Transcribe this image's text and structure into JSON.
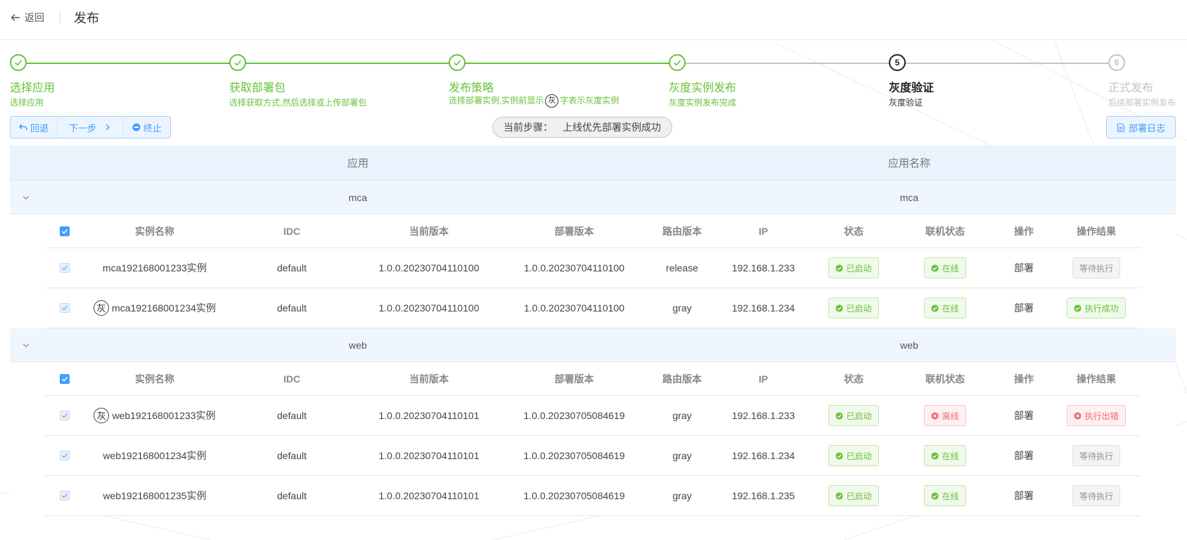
{
  "header": {
    "back_label": "返回",
    "title": "发布"
  },
  "steps": [
    {
      "num": "1",
      "title": "选择应用",
      "desc": "选择应用",
      "state": "done"
    },
    {
      "num": "2",
      "title": "获取部署包",
      "desc": "选择获取方式,然后选择或上传部署包",
      "state": "done"
    },
    {
      "num": "3",
      "title": "发布策略",
      "desc_pre": "选择部署实例,实例前显示",
      "desc_mark": "灰",
      "desc_post": "字表示灰度实例",
      "state": "done"
    },
    {
      "num": "4",
      "title": "灰度实例发布",
      "desc": "灰度实例发布完成",
      "state": "done"
    },
    {
      "num": "5",
      "title": "灰度验证",
      "desc": "灰度验证",
      "state": "current"
    },
    {
      "num": "6",
      "title": "正式发布",
      "desc": "后续部署实例发布",
      "state": "pending"
    }
  ],
  "toolbar": {
    "rollback_label": "回退",
    "next_label": "下一步",
    "stop_label": "终止",
    "current_step_label": "当前步骤：",
    "current_step_value": "上线优先部署实例成功",
    "log_label": "部署日志"
  },
  "table": {
    "head_app": "应用",
    "head_app_name": "应用名称",
    "sub_headers": {
      "name": "实例名称",
      "idc": "IDC",
      "current_version": "当前版本",
      "deploy_version": "部署版本",
      "route_version": "路由版本",
      "ip": "IP",
      "status": "状态",
      "online_status": "联机状态",
      "operation": "操作",
      "result": "操作结果"
    },
    "groups": [
      {
        "app": "mca",
        "app_name": "mca",
        "rows": [
          {
            "gray": false,
            "gray_mark": "",
            "name": "mca192168001233实例",
            "idc": "default",
            "current_version": "1.0.0.20230704110100",
            "deploy_version": "1.0.0.20230704110100",
            "route_version": "release",
            "ip": "192.168.1.233",
            "status": "已启动",
            "online": "在线",
            "online_state": "green",
            "operation": "部署",
            "result": "等待执行",
            "result_state": "grey"
          },
          {
            "gray": true,
            "gray_mark": "灰",
            "name": "mca192168001234实例",
            "idc": "default",
            "current_version": "1.0.0.20230704110100",
            "deploy_version": "1.0.0.20230704110100",
            "route_version": "gray",
            "ip": "192.168.1.234",
            "status": "已启动",
            "online": "在线",
            "online_state": "green",
            "operation": "部署",
            "result": "执行成功",
            "result_state": "green"
          }
        ]
      },
      {
        "app": "web",
        "app_name": "web",
        "rows": [
          {
            "gray": true,
            "gray_mark": "灰",
            "name": "web192168001233实例",
            "idc": "default",
            "current_version": "1.0.0.20230704110101",
            "deploy_version": "1.0.0.20230705084619",
            "route_version": "gray",
            "ip": "192.168.1.233",
            "status": "已启动",
            "online": "离线",
            "online_state": "red",
            "operation": "部署",
            "result": "执行出错",
            "result_state": "red"
          },
          {
            "gray": false,
            "gray_mark": "",
            "name": "web192168001234实例",
            "idc": "default",
            "current_version": "1.0.0.20230704110101",
            "deploy_version": "1.0.0.20230705084619",
            "route_version": "gray",
            "ip": "192.168.1.234",
            "status": "已启动",
            "online": "在线",
            "online_state": "green",
            "operation": "部署",
            "result": "等待执行",
            "result_state": "grey"
          },
          {
            "gray": false,
            "gray_mark": "",
            "name": "web192168001235实例",
            "idc": "default",
            "current_version": "1.0.0.20230704110101",
            "deploy_version": "1.0.0.20230705084619",
            "route_version": "gray",
            "ip": "192.168.1.235",
            "status": "已启动",
            "online": "在线",
            "online_state": "green",
            "operation": "部署",
            "result": "等待执行",
            "result_state": "grey"
          }
        ]
      }
    ]
  },
  "colors": {
    "done": "#67c23a",
    "primary": "#409eff",
    "danger": "#f56c6c",
    "pending": "#c0c4cc"
  }
}
